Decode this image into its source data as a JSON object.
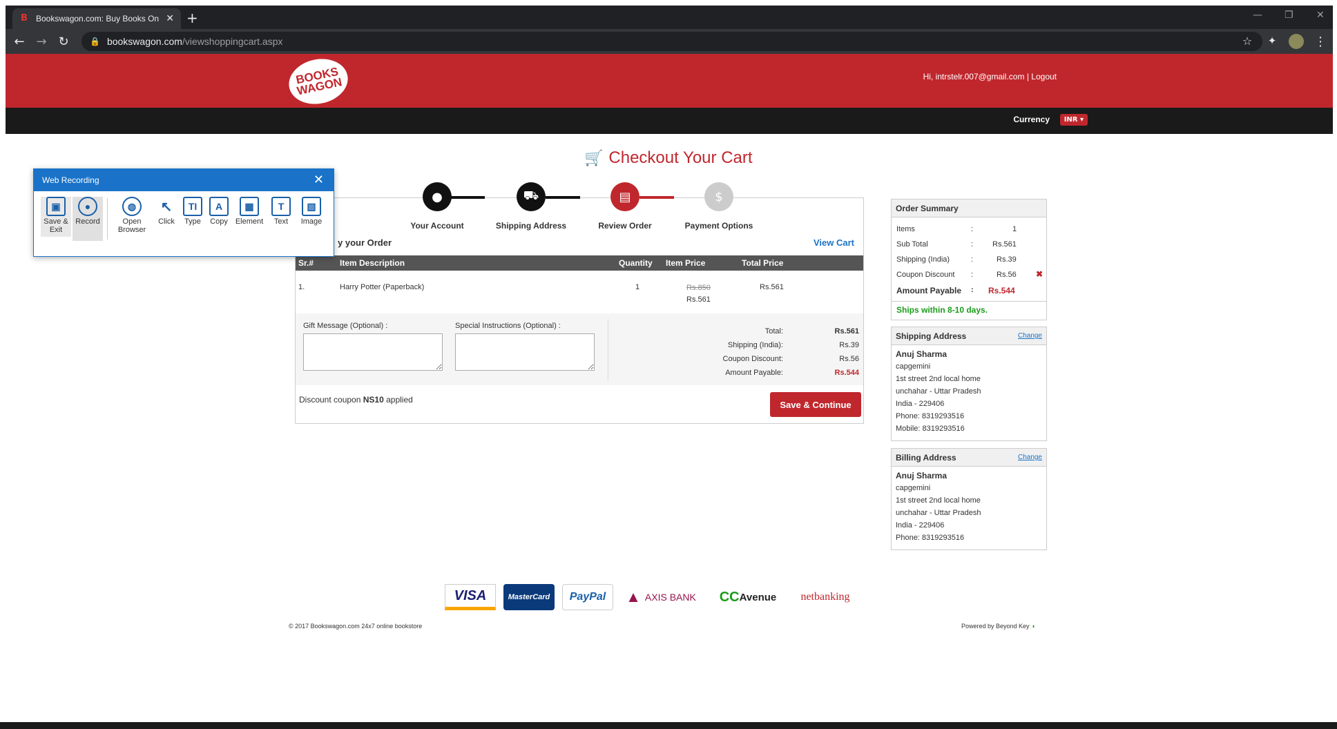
{
  "browser": {
    "tab_title": "Bookswagon.com: Buy Books Onl",
    "url_host": "bookswagon.com",
    "url_path": "/viewshoppingcart.aspx"
  },
  "header": {
    "logo_top": "BOOKS",
    "logo_bottom": "WAGON",
    "user_greeting": "Hi, intrstelr.007@gmail.com",
    "separator": "|",
    "logout": "Logout",
    "currency_label": "Currency",
    "currency_value": "INR ▾"
  },
  "checkout": {
    "title": "Checkout Your Cart",
    "steps": [
      {
        "label": "Your Account"
      },
      {
        "label": "Shipping Address"
      },
      {
        "label": "Review Order"
      },
      {
        "label": "Payment Options"
      }
    ],
    "review_heading": "y your Order",
    "view_cart": "View Cart",
    "table_headers": [
      "Sr.#",
      "Item Description",
      "Quantity",
      "Item Price",
      "Total Price"
    ],
    "item": {
      "sr": "1.",
      "description": "Harry Potter (Paperback)",
      "quantity": "1",
      "orig_price": "Rs.850",
      "price": "Rs.561",
      "total": "Rs.561"
    },
    "gift_label": "Gift Message (Optional) :",
    "special_label": "Special Instructions (Optional) :",
    "totals": {
      "total_label": "Total:",
      "total_value": "Rs.561",
      "shipping_label": "Shipping (India):",
      "shipping_value": "Rs.39",
      "coupon_label": "Coupon Discount:",
      "coupon_value": "Rs.56",
      "payable_label": "Amount Payable:",
      "payable_value": "Rs.544"
    },
    "coupon_text": "Discount coupon",
    "coupon_code": "NS10",
    "coupon_applied": "applied",
    "save_button": "Save & Continue"
  },
  "order_summary": {
    "title": "Order Summary",
    "rows": [
      {
        "label": "Items",
        "sep": ":",
        "value": "1"
      },
      {
        "label": "Sub Total",
        "sep": ":",
        "value": "Rs.561"
      },
      {
        "label": "Shipping (India)",
        "sep": ":",
        "value": "Rs.39"
      },
      {
        "label": "Coupon Discount",
        "sep": ":",
        "value": "Rs.56"
      },
      {
        "label": "Amount Payable",
        "sep": ":",
        "value": "Rs.544"
      }
    ],
    "ships_note": "Ships within 8-10 days."
  },
  "shipping_address": {
    "title": "Shipping Address",
    "change": "Change",
    "name": "Anuj Sharma",
    "lines": [
      "capgemini",
      "1st street 2nd local home",
      "unchahar - Uttar Pradesh",
      "India - 229406",
      "Phone: 8319293516",
      "Mobile: 8319293516"
    ]
  },
  "billing_address": {
    "title": "Billing Address",
    "change": "Change",
    "name": "Anuj Sharma",
    "lines": [
      "capgemini",
      "1st street 2nd local home",
      "unchahar - Uttar Pradesh",
      "India - 229406",
      "Phone: 8319293516"
    ]
  },
  "payment_logos": [
    "VISA",
    "MasterCard",
    "PayPal",
    "AXIS BANK",
    "Avenue",
    "netbanking"
  ],
  "footer": {
    "copyright": "© 2017 Bookswagon.com 24x7 online bookstore",
    "powered": "Powered by Beyond Key"
  },
  "web_recording": {
    "title": "Web Recording",
    "tools": [
      "Save & Exit",
      "Record",
      "Open Browser",
      "Click",
      "Type",
      "Copy",
      "Element",
      "Text",
      "Image"
    ]
  },
  "colors": {
    "brand_red": "#c0272d",
    "link_blue": "#1a73c8",
    "success_green": "#1a9c1a"
  }
}
